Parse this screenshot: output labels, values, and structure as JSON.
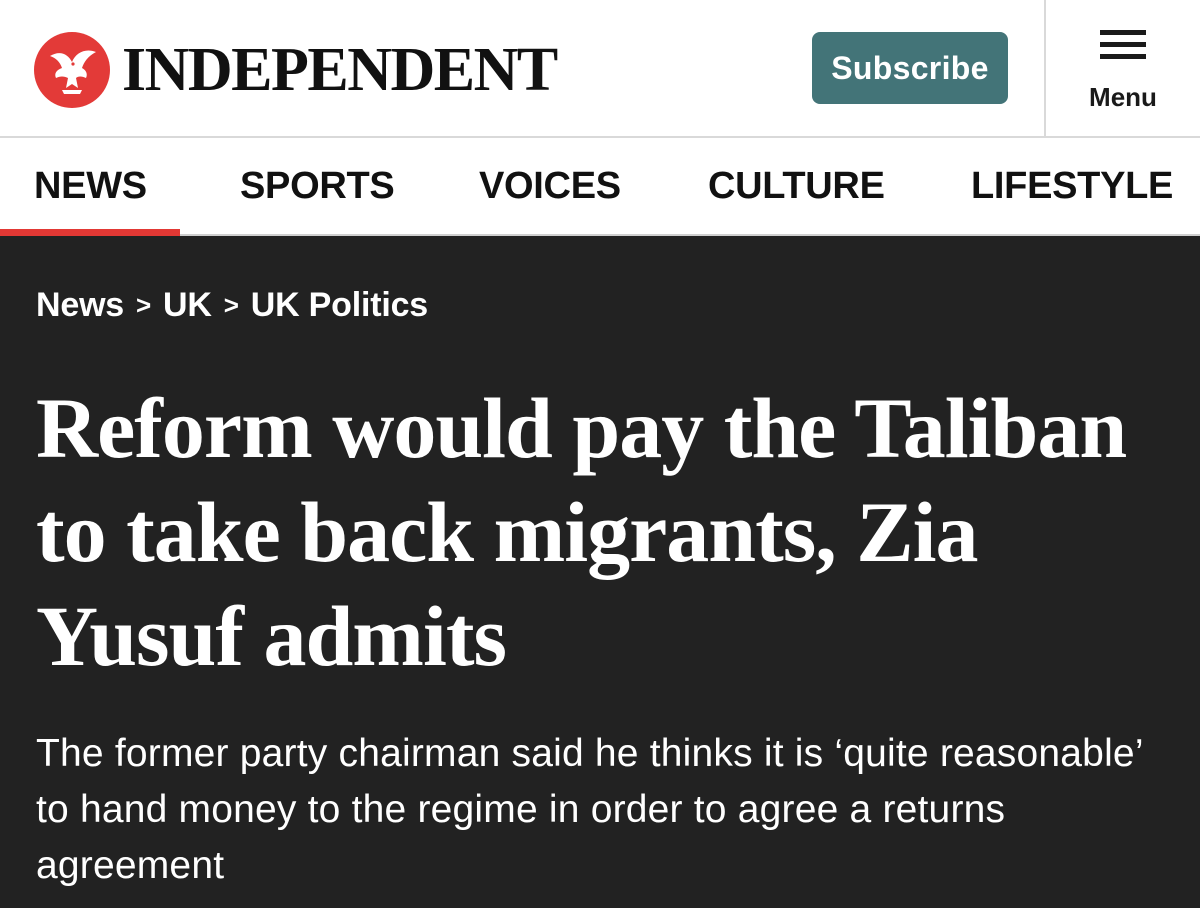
{
  "header": {
    "logo_text": "INDEPENDENT",
    "logo_icon": "eagle-icon",
    "subscribe_label": "Subscribe",
    "menu_label": "Menu",
    "menu_icon": "hamburger-icon"
  },
  "nav": {
    "items": [
      {
        "label": "NEWS",
        "active": true
      },
      {
        "label": "SPORTS",
        "active": false
      },
      {
        "label": "VOICES",
        "active": false
      },
      {
        "label": "CULTURE",
        "active": false
      },
      {
        "label": "LIFESTYLE",
        "active": false
      }
    ]
  },
  "article": {
    "breadcrumb": [
      "News",
      "UK",
      "UK Politics"
    ],
    "breadcrumb_separator": ">",
    "headline": "Reform would pay the Taliban to take back migrants, Zia Yusuf admits",
    "standfirst": "The former party chairman said he thinks it is ‘quite reasonable’ to hand money to the regime in order to agree a returns agreement"
  },
  "colors": {
    "brand_red": "#e33a38",
    "subscribe_teal": "#437478",
    "hero_background": "#222222",
    "nav_active_underline": "#e23834"
  }
}
